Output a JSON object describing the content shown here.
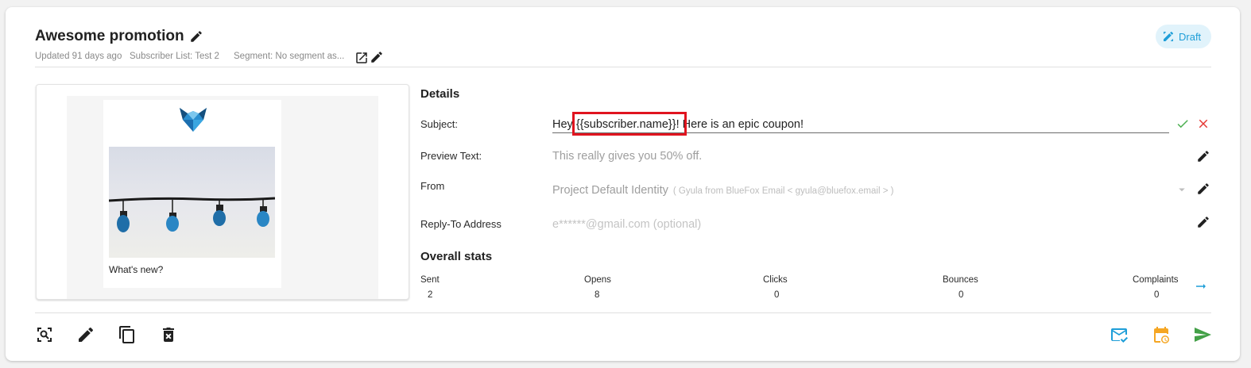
{
  "header": {
    "title": "Awesome promotion",
    "updated": "Updated 91 days ago",
    "subscriber_list": "Subscriber List: Test 2",
    "segment": "Segment: No segment as...",
    "status": "Draft",
    "status_color": "#1e9ed8"
  },
  "preview": {
    "caption": "What's new?"
  },
  "details": {
    "heading": "Details",
    "subject_label": "Subject:",
    "subject_value": "Hey {{subscriber.name}}! Here is an epic coupon!",
    "preview_text_label": "Preview Text:",
    "preview_text_value": "This really gives you 50% off.",
    "from_label": "From",
    "from_value": "Project Default Identity",
    "from_detail": "( Gyula from BlueFox Email < gyula@bluefox.email > )",
    "reply_to_label": "Reply-To Address",
    "reply_to_placeholder": "e******@gmail.com (optional)"
  },
  "stats": {
    "heading": "Overall stats",
    "items": [
      {
        "label": "Sent",
        "value": "2"
      },
      {
        "label": "Opens",
        "value": "8"
      },
      {
        "label": "Clicks",
        "value": "0"
      },
      {
        "label": "Bounces",
        "value": "0"
      },
      {
        "label": "Complaints",
        "value": "0"
      }
    ]
  },
  "colors": {
    "accept": "#4caf50",
    "cancel": "#e53935",
    "link_arrow": "#1e9ed8",
    "send_test": "#1e9ed8",
    "schedule": "#f5a623",
    "send": "#43a047",
    "highlight_box": "#e0141f"
  },
  "icons": {
    "title_edit": "pencil-icon",
    "segment_open": "open-in-new-icon",
    "segment_edit": "pencil-icon",
    "status": "pencil-ruler-icon",
    "accept": "check-icon",
    "cancel": "close-icon",
    "dropdown": "caret-down-icon",
    "stats_more": "arrow-right-icon",
    "toolbar": [
      "zoom-preview-icon",
      "pencil-icon",
      "copy-icon",
      "delete-icon",
      "send-test-email-icon",
      "schedule-icon",
      "send-icon"
    ]
  }
}
